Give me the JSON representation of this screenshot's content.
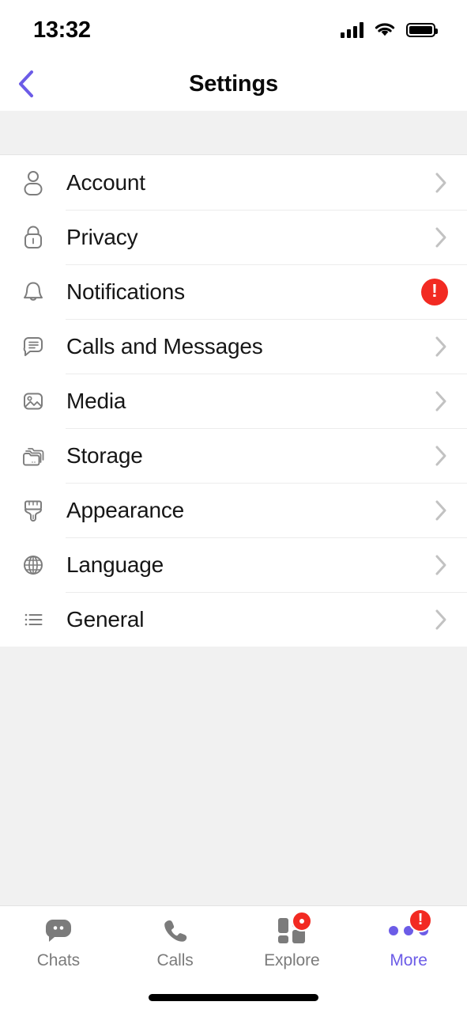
{
  "status_bar": {
    "time": "13:32",
    "signal_icon": "cellular-signal-icon",
    "wifi_icon": "wifi-icon",
    "battery_icon": "battery-full-icon"
  },
  "nav_bar": {
    "title": "Settings",
    "back_icon": "chevron-left-icon",
    "back_color": "#6c5ce7"
  },
  "settings": {
    "items": [
      {
        "label": "Account",
        "icon": "person-icon",
        "accessory": "chevron"
      },
      {
        "label": "Privacy",
        "icon": "lock-icon",
        "accessory": "chevron"
      },
      {
        "label": "Notifications",
        "icon": "bell-icon",
        "accessory": "alert-badge",
        "badge": "!"
      },
      {
        "label": "Calls and Messages",
        "icon": "chat-bubble-icon",
        "accessory": "chevron"
      },
      {
        "label": "Media",
        "icon": "photo-icon",
        "accessory": "chevron"
      },
      {
        "label": "Storage",
        "icon": "folders-icon",
        "accessory": "chevron"
      },
      {
        "label": "Appearance",
        "icon": "paintbrush-icon",
        "accessory": "chevron"
      },
      {
        "label": "Language",
        "icon": "globe-icon",
        "accessory": "chevron"
      },
      {
        "label": "General",
        "icon": "list-icon",
        "accessory": "chevron"
      }
    ]
  },
  "tab_bar": {
    "tabs": [
      {
        "label": "Chats",
        "icon": "chat-bubble-filled-icon",
        "active": false,
        "badge": null
      },
      {
        "label": "Calls",
        "icon": "phone-icon",
        "active": false,
        "badge": null
      },
      {
        "label": "Explore",
        "icon": "grid-icon",
        "active": false,
        "badge": "dot"
      },
      {
        "label": "More",
        "icon": "three-dots-icon",
        "active": true,
        "badge": "!"
      }
    ],
    "active_color": "#6c5ce7",
    "inactive_color": "#7b7b7b",
    "badge_color": "#f22a22"
  },
  "home_indicator": "home-indicator-bar"
}
